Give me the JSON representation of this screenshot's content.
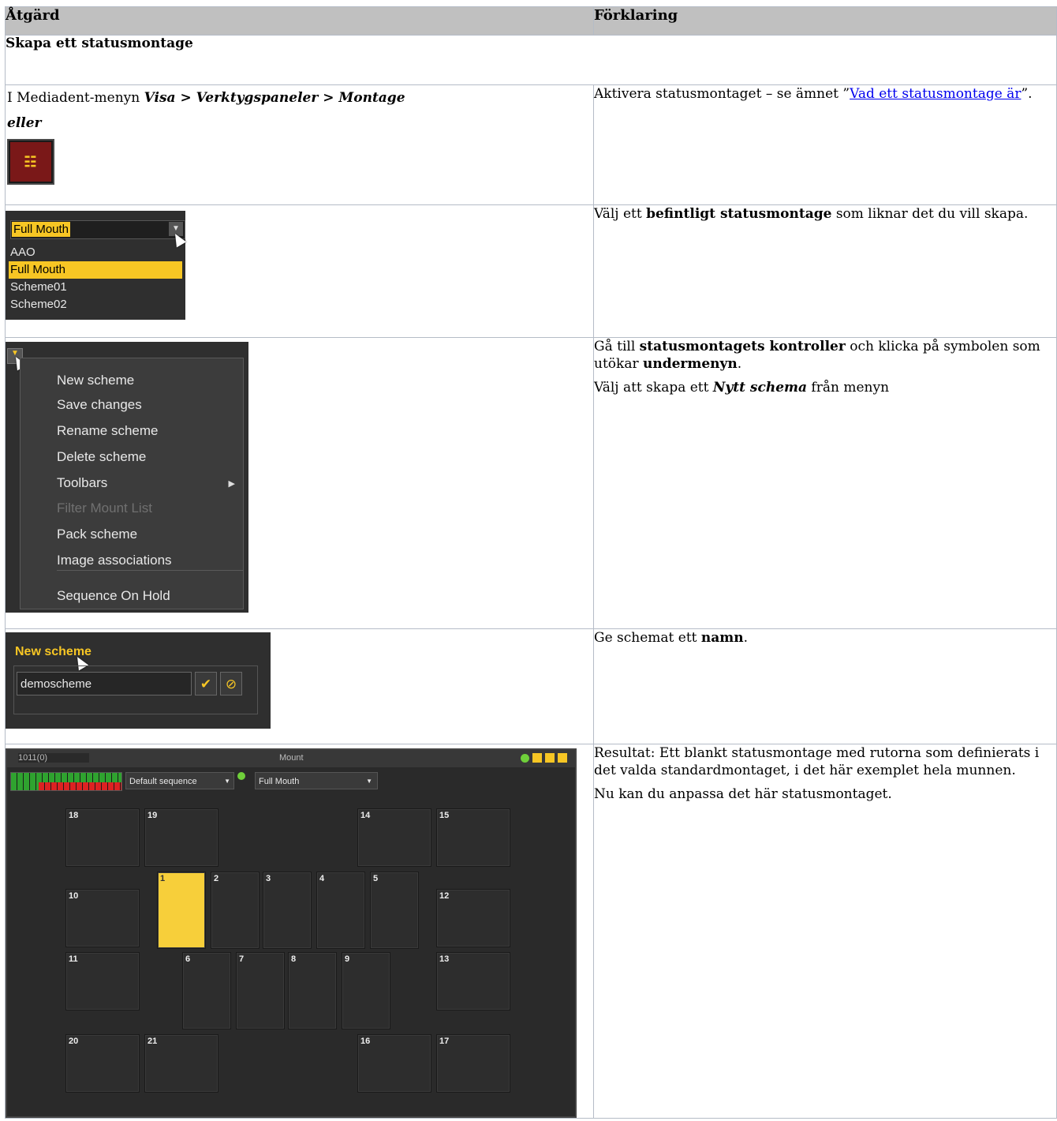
{
  "table": {
    "header_action": "Åtgärd",
    "header_explanation": "Förklaring",
    "section_title": "Skapa ett statusmontage"
  },
  "rows": [
    {
      "action_prefix": "I Mediadent-menyn ",
      "action_path_1": "Visa",
      "action_sep": " > ",
      "action_path_2": "Verktygspaneler",
      "action_path_3": "Montage",
      "action_or": "eller",
      "icon": "mount-grid-icon",
      "explanation_prefix": "Aktivera statusmontaget – se ämnet ”",
      "explanation_link": "Vad ett statusmontage är",
      "explanation_suffix": "”."
    },
    {
      "dropdown": {
        "selected": "Full Mouth",
        "options": [
          "AAO",
          "Full Mouth",
          "Scheme01",
          "Scheme02"
        ]
      },
      "explanation_prefix": "Välj ett ",
      "explanation_bold": "befintligt statusmontage",
      "explanation_suffix": " som liknar det du vill skapa."
    },
    {
      "menu": [
        {
          "label": "New scheme",
          "disabled": false
        },
        {
          "label": "Save changes",
          "disabled": false
        },
        {
          "label": "Rename scheme",
          "disabled": false
        },
        {
          "label": "Delete scheme",
          "disabled": false
        },
        {
          "label": "Toolbars",
          "disabled": false
        },
        {
          "label": "Filter Mount List",
          "disabled": true
        },
        {
          "label": "Pack scheme",
          "disabled": false
        },
        {
          "label": "Image associations",
          "disabled": false
        },
        {
          "label": "Sequence On Hold",
          "disabled": false
        }
      ],
      "explanation_p1_a": "Gå till ",
      "explanation_p1_b": "statusmontagets kontroller",
      "explanation_p1_c": " och klicka på symbolen som utökar ",
      "explanation_p1_d": "undermenyn",
      "explanation_p1_e": ".",
      "explanation_p2_a": "Välj att skapa ett ",
      "explanation_p2_b": "Nytt schema",
      "explanation_p2_c": " från menyn"
    },
    {
      "dialog": {
        "title": "New scheme",
        "value": "demoscheme"
      },
      "explanation_prefix": "Ge schemat ett ",
      "explanation_bold": "namn",
      "explanation_suffix": "."
    },
    {
      "mount": {
        "counter": "1011(0)",
        "title": "Mount",
        "sequence": "Default sequence",
        "scheme": "Full Mouth",
        "slots": [
          "18",
          "19",
          "14",
          "15",
          "1",
          "2",
          "3",
          "4",
          "5",
          "10",
          "12",
          "11",
          "6",
          "7",
          "8",
          "9",
          "13",
          "20",
          "21",
          "16",
          "17"
        ]
      },
      "explanation_p1": "Resultat: Ett blankt statusmontage med rutorna som definierats i det valda standardmontaget, i det här exemplet hela munnen.",
      "explanation_p2": "Nu kan du anpassa det här statusmontaget."
    }
  ],
  "colors": {
    "accent": "#f7c624",
    "header_bg": "#c0c0c0",
    "link": "#0000ee"
  }
}
